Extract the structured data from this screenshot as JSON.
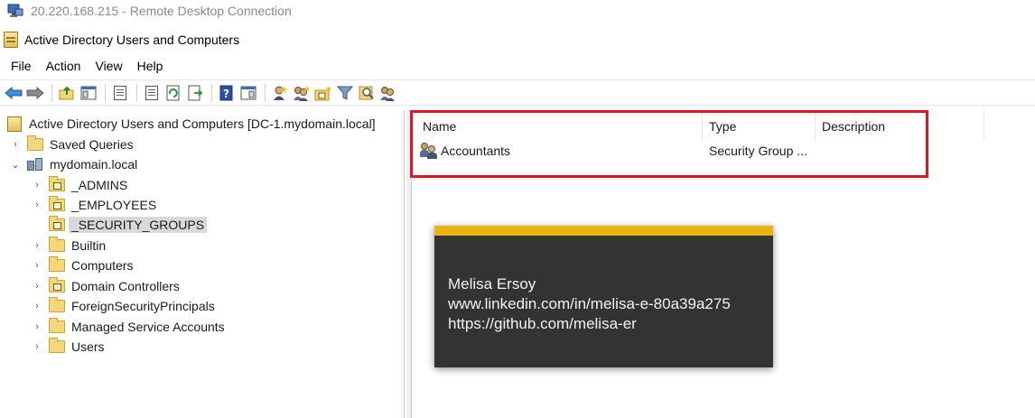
{
  "remote": {
    "title": "20.220.168.215 - Remote Desktop Connection"
  },
  "window": {
    "title": "Active Directory Users and Computers"
  },
  "menu": [
    "File",
    "Action",
    "View",
    "Help"
  ],
  "toolbar": {
    "icons": [
      "back-arrow-icon",
      "forward-arrow-icon",
      "up-folder-icon",
      "show-console-tree-icon",
      "properties-sheet-icon",
      "export-list-icon",
      "refresh-icon",
      "export-icon",
      "help-icon",
      "show-action-pane-icon",
      "new-user-icon",
      "new-group-icon",
      "new-ou-icon",
      "filter-icon",
      "find-icon",
      "add-to-group-icon"
    ]
  },
  "tree": {
    "root": "Active Directory Users and Computers [DC-1.mydomain.local]",
    "saved_queries": "Saved Queries",
    "domain": "mydomain.local",
    "children": [
      {
        "label": "_ADMINS",
        "type": "ou"
      },
      {
        "label": "_EMPLOYEES",
        "type": "ou"
      },
      {
        "label": "_SECURITY_GROUPS",
        "type": "ou",
        "selected": true
      },
      {
        "label": "Builtin",
        "type": "folder"
      },
      {
        "label": "Computers",
        "type": "folder"
      },
      {
        "label": "Domain Controllers",
        "type": "ou"
      },
      {
        "label": "ForeignSecurityPrincipals",
        "type": "folder"
      },
      {
        "label": "Managed Service Accounts",
        "type": "folder"
      },
      {
        "label": "Users",
        "type": "folder"
      }
    ]
  },
  "list": {
    "columns": [
      "Name",
      "Type",
      "Description"
    ],
    "rows": [
      {
        "name": "Accountants",
        "type": "Security Group ...",
        "description": ""
      }
    ]
  },
  "overlay": {
    "line1": "Melisa Ersoy",
    "line2": "www.linkedin.com/in/melisa-e-80a39a275",
    "line3": "https://github.com/melisa-er"
  },
  "colors": {
    "highlight": "#e0161e",
    "card_bg": "#333333",
    "card_accent": "#e8b40e",
    "selection": "#d9d9d9"
  }
}
